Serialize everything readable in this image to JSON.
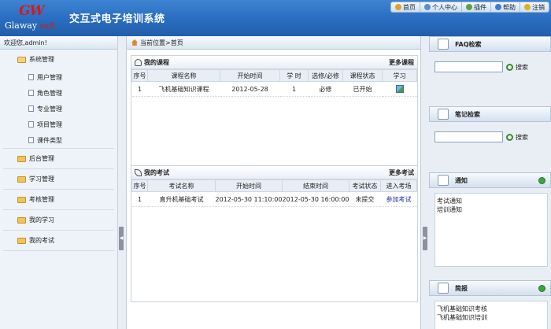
{
  "header": {
    "logo_mark": "GW",
    "logo_text": "Glaway",
    "logo_soft": "soft.",
    "title": "交互式电子培训系统",
    "nav": [
      {
        "label": "首页",
        "icon": "home-icon",
        "color": "#e0a030"
      },
      {
        "label": "个人中心",
        "icon": "user-icon",
        "color": "#5a8fd0"
      },
      {
        "label": "插件",
        "icon": "plugin-icon",
        "color": "#60a040"
      },
      {
        "label": "帮助",
        "icon": "help-icon",
        "color": "#3a7fd0"
      },
      {
        "label": "注销",
        "icon": "logout-icon",
        "color": "#e0b020"
      }
    ]
  },
  "sidebar": {
    "welcome": "欢迎您,admin!",
    "groups": [
      {
        "label": "系统管理",
        "children": [
          "用户管理",
          "角色管理",
          "专业管理",
          "项目管理",
          "课件类型"
        ]
      },
      {
        "label": "后台管理"
      },
      {
        "label": "学习管理"
      },
      {
        "label": "考核管理"
      },
      {
        "label": "我的学习"
      },
      {
        "label": "我的考试"
      }
    ]
  },
  "breadcrumb": "当前位置>首页",
  "courses": {
    "title": "我的课程",
    "more": "更多课程",
    "columns": [
      "序号",
      "课程名称",
      "开始时间",
      "学 时",
      "选修/必修",
      "课程状态",
      "学习"
    ],
    "rows": [
      {
        "no": "1",
        "name": "飞机基础知识课程",
        "start": "2012-05-28",
        "hours": "1",
        "type": "必修",
        "status": "已开始"
      }
    ]
  },
  "exams": {
    "title": "我的考试",
    "more": "更多考试",
    "columns": [
      "序号",
      "考试名称",
      "开始时间",
      "结束时间",
      "考试状态",
      "进入考场"
    ],
    "rows": [
      {
        "no": "1",
        "name": "直升机基础考试",
        "start": "2012-05-30 11:10:00",
        "end": "2012-05-30 16:00:00",
        "status": "未提交",
        "action": "参加考试"
      }
    ]
  },
  "right": {
    "faq": {
      "title": "FAQ检索",
      "button": "搜索",
      "placeholder": ""
    },
    "notes": {
      "title": "笔记检索",
      "button": "搜索",
      "placeholder": ""
    },
    "notice": {
      "title": "通知",
      "items": [
        "考试通知",
        "培训通知"
      ]
    },
    "news": {
      "title": "简报",
      "items": [
        "飞机基础知识考核",
        "飞机基础知识培训"
      ]
    }
  },
  "colors": {
    "header": "#2a6cc0",
    "accent": "#1a2fa0"
  }
}
